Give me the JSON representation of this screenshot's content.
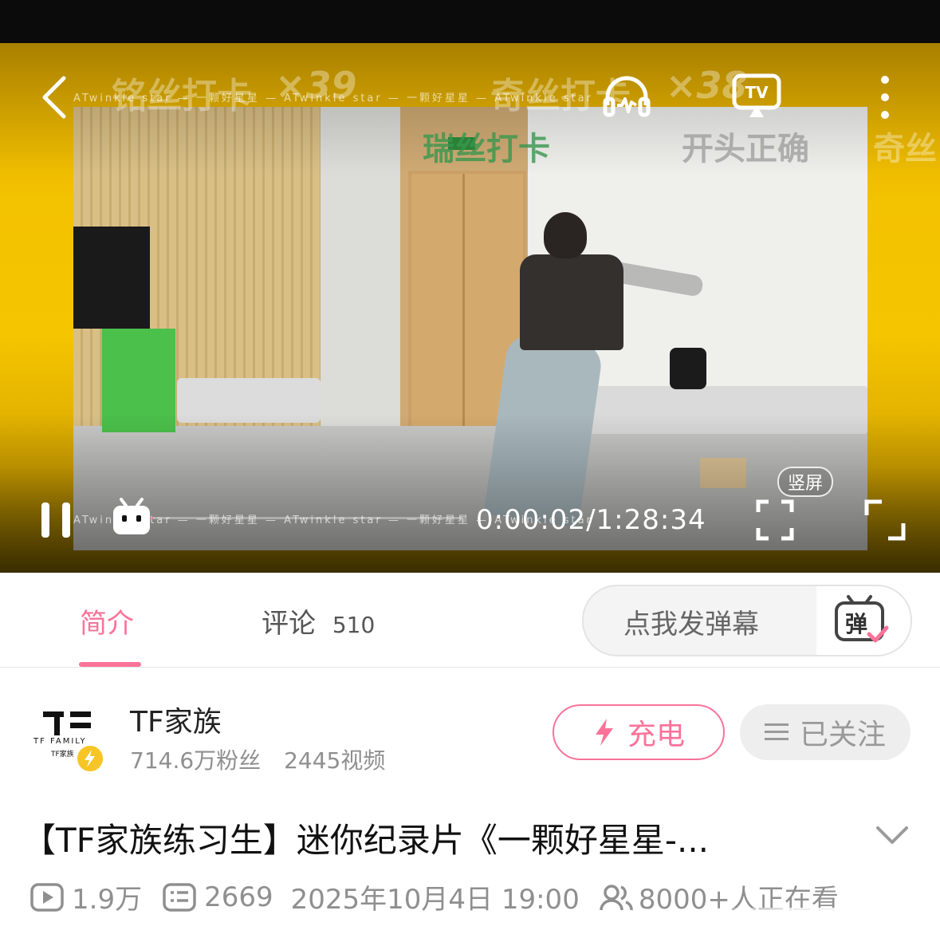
{
  "player": {
    "watermarks": {
      "top_left": "铭丝打卡",
      "count_left": "×39",
      "top_mid": "奇丝打卡",
      "count_right": "×38",
      "green": "瑞丝打卡",
      "right_caption": "开头正确",
      "far_right": "奇丝"
    },
    "frame_text": "ATwinkle star — 一颗好星星 — ATwinkle star — 一颗好星星 — ATwinkle star",
    "vertical_label": "竖屏",
    "time": "0:00:02/1:28:34",
    "progress": 0.0004
  },
  "tabs": {
    "intro": "简介",
    "comments": "评论",
    "comments_count": "510",
    "danmaku_placeholder": "点我发弹幕",
    "danmaku_icon_label": "弹"
  },
  "uploader": {
    "name": "TF家族",
    "logo_text": "TF FAMILY",
    "logo_sub": "TF家族",
    "fans": "714.6万粉丝",
    "videos": "2445视频",
    "charge_label": "充电",
    "follow_label": "已关注"
  },
  "video": {
    "title": "【TF家族练习生】迷你纪录片《一颗好星星-...",
    "views": "1.9万",
    "danmaku_count": "2669",
    "date": "2025年10月4日 19:00",
    "watching": "8000+人正在看"
  },
  "colors": {
    "pink": "#fb7299",
    "player_yellow": "#f5c500",
    "meta_gray": "#8f8f8f",
    "lightning_yellow": "#f7c626"
  }
}
